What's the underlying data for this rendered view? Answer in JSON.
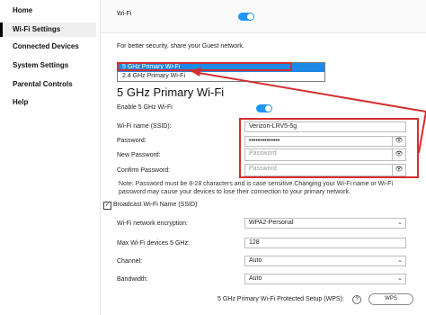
{
  "sidebar": {
    "items": [
      {
        "label": "Home"
      },
      {
        "label": "Wi-Fi Settings"
      },
      {
        "label": "Connected Devices"
      },
      {
        "label": "System Settings"
      },
      {
        "label": "Parental Controls"
      },
      {
        "label": "Help"
      }
    ]
  },
  "wifi": {
    "label": "Wi-Fi"
  },
  "guest_text": "For better security, share your Guest network.",
  "dropdown": {
    "options": [
      "5 GHz Primary Wi-Fi",
      "2.4 GHz Primary Wi-Fi"
    ],
    "selected": "5 GHz Primary Wi-Fi"
  },
  "section_title": "5 GHz Primary Wi-Fi",
  "enable_label": "Enable 5 GHz Wi-Fi",
  "form": {
    "ssid_label": "Wi-Fi name (SSID):",
    "ssid_value": "Verizon-LRV5-5g",
    "password_label": "Password:",
    "password_value": "••••••••••••••",
    "new_password_label": "New Password:",
    "new_password_placeholder": "Password",
    "confirm_password_label": "Confirm Password:",
    "confirm_password_placeholder": "Password"
  },
  "note": "Note: Password must be 8-28 characters and is case sensitive.Changing your Wi-Fi name or Wi-Fi password may cause your devices to lose their connection to your primary network.",
  "broadcast_label": "Broadcast Wi-Fi Name (SSID)",
  "encryption": {
    "label": "Wi-Fi network encryption:",
    "value": "WPA2-Personal"
  },
  "max_devices": {
    "label": "Max Wi-Fi devices 5 GHz:",
    "value": "128"
  },
  "channel": {
    "label": "Channel:",
    "value": "Auto"
  },
  "bandwidth": {
    "label": "Bandwidth:",
    "value": "Auto"
  },
  "wps": {
    "label": "5 GHz Primary Wi-Fi Protected Setup (WPS):",
    "help": "?",
    "button": "WPS"
  },
  "colors": {
    "accent": "#2196f3",
    "annotation": "#d32f2f"
  }
}
